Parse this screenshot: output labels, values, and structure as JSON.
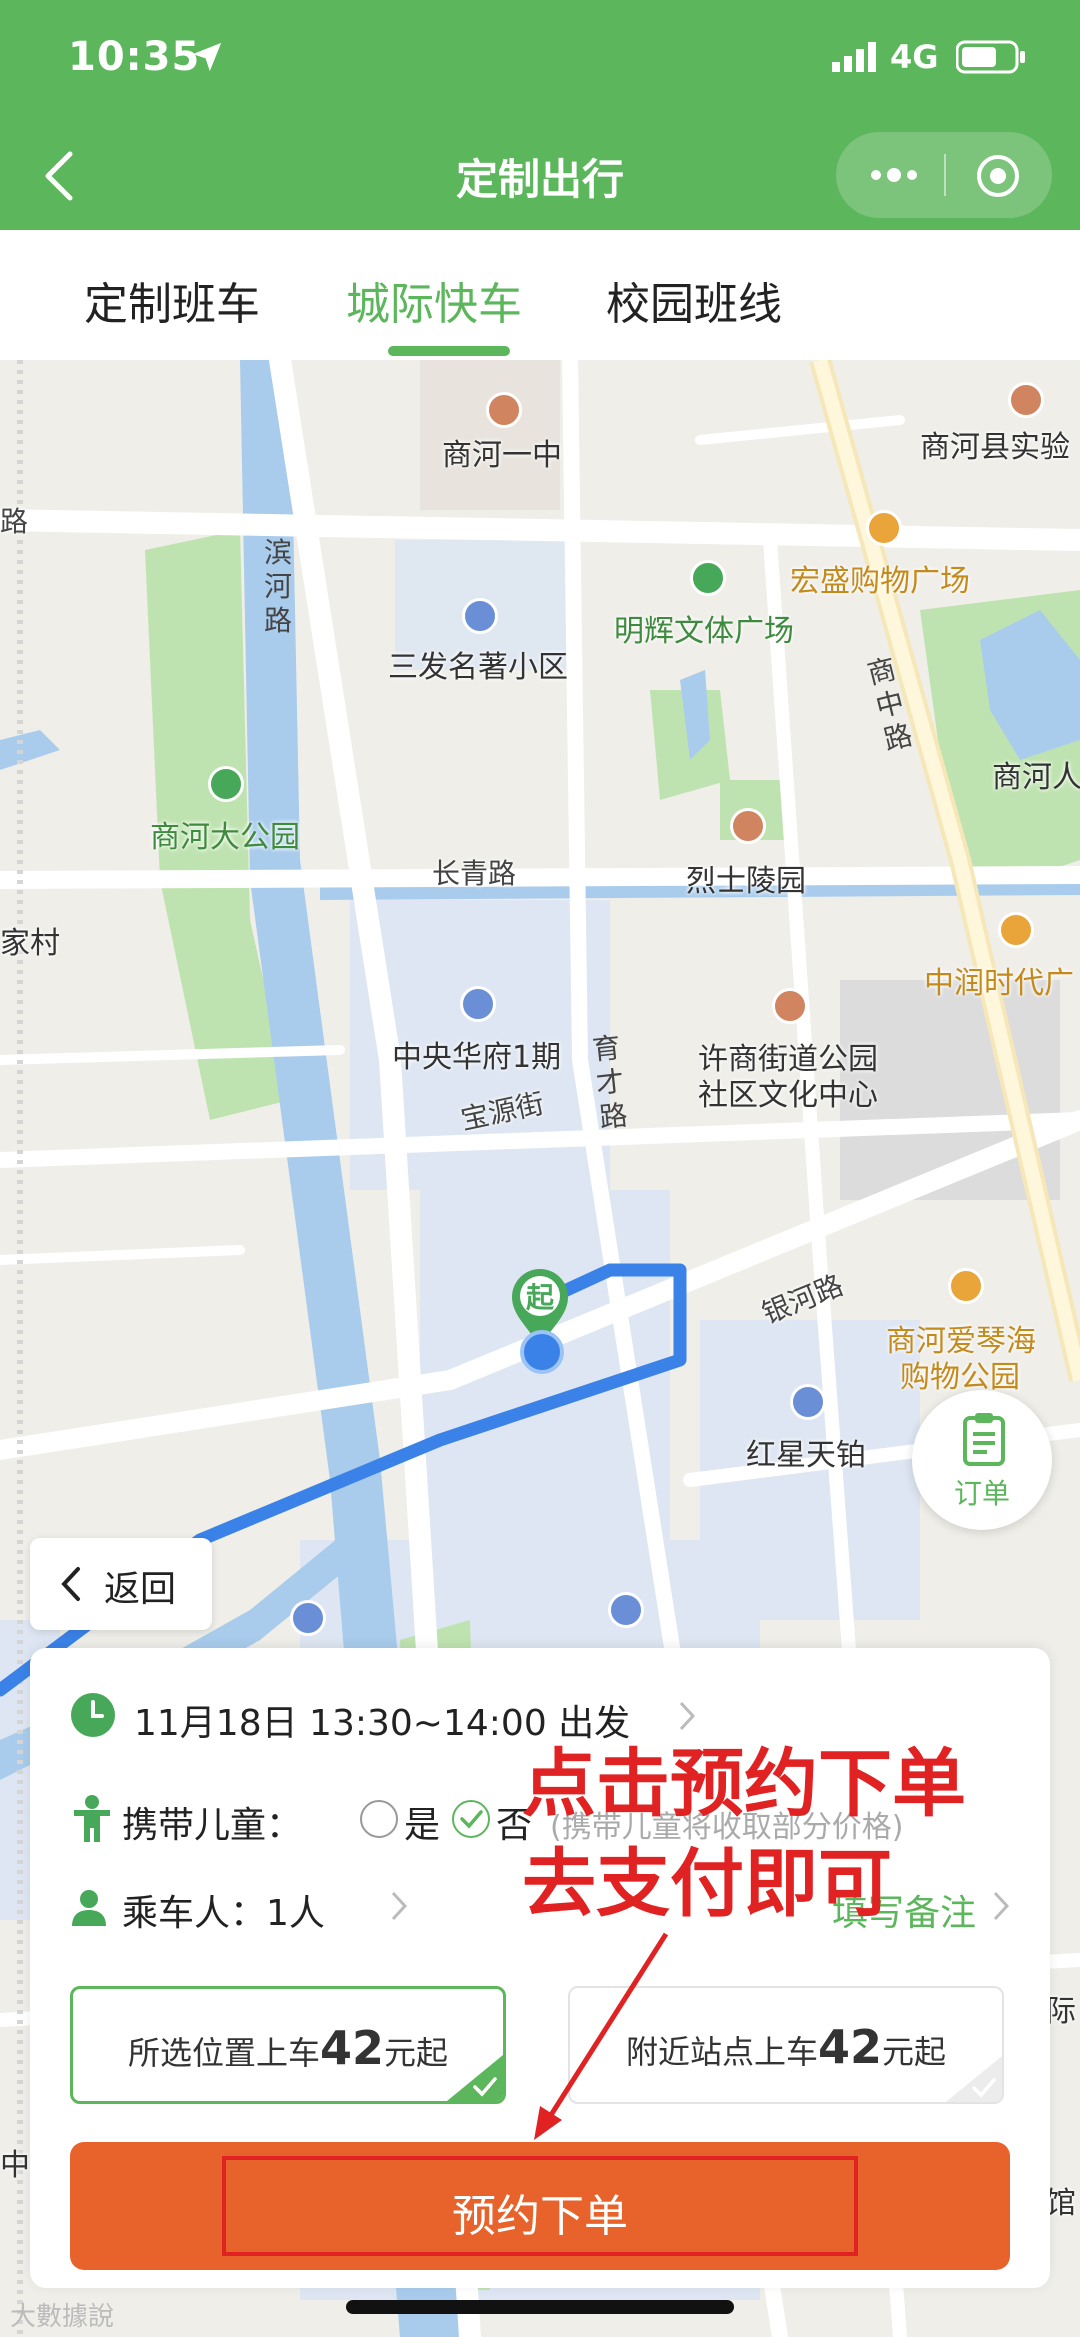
{
  "status": {
    "time": "10:35",
    "network": "4G"
  },
  "nav": {
    "title": "定制出行"
  },
  "tabs": [
    {
      "label": "定制班车",
      "active": false
    },
    {
      "label": "城际快车",
      "active": true
    },
    {
      "label": "校园班线",
      "active": false
    }
  ],
  "map": {
    "labels": {
      "school": "商河一中",
      "school2": "商河县实验",
      "mall": "宏盛购物广场",
      "plaza": "明辉文体广场",
      "community1": "三发名著小区",
      "park": "商河大公园",
      "park2": "商河人",
      "cemetery": "烈士陵园",
      "road_changqing": "长青路",
      "zhongrun": "中润时代广",
      "huafu": "中央华府1期",
      "culture_center_1": "许商街道公园",
      "culture_center_2": "社区文化中心",
      "road_baoyuan": "宝源街",
      "road_yinhe": "银河路",
      "aiqinhai_1": "商河爱琴海",
      "aiqinhai_2": "购物公园",
      "hongxing": "红星天铂",
      "edge_lu": "路",
      "edge_cun": "家村",
      "edge_ji": "际",
      "edge_guan": "馆",
      "edge_zhong": "中"
    },
    "vertical_labels": {
      "road_binhe": "滨河路",
      "road_shangzhong": "商中路",
      "road_yucai": "育才路"
    },
    "start_marker": "起",
    "order_label": "订单",
    "back_label": "返回"
  },
  "panel": {
    "time_text": "11月18日 13:30~14:00 出发",
    "child_label": "携带儿童：",
    "child_yes": "是",
    "child_no": "否",
    "child_selected": "否",
    "child_note": "(携带儿童将收取部分价格)",
    "passenger_label": "乘车人：",
    "passenger_count": "1人",
    "remark_label": "填写备注",
    "options": [
      {
        "prefix": "所选位置上车",
        "price": "42",
        "suffix": "元起",
        "selected": true
      },
      {
        "prefix": "附近站点上车",
        "price": "42",
        "suffix": "元起",
        "selected": false
      }
    ],
    "submit_label": "预约下单"
  },
  "annotation": {
    "line1": "点击预约下单",
    "line2": "去支付即可"
  },
  "watermark": "大數據說",
  "colors": {
    "brand_green": "#5cb65c",
    "submit_orange": "#e8622c",
    "annotation_red": "#e02222",
    "route_blue": "#3a82e8"
  }
}
